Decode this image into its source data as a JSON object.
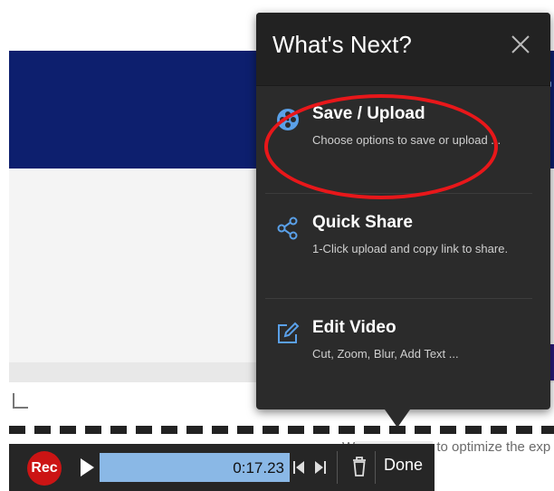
{
  "popup": {
    "title": "What's Next?",
    "close": "X",
    "options": [
      {
        "label": "Save / Upload",
        "desc": "Choose options to save or upload ..."
      },
      {
        "label": "Quick Share",
        "desc": "1-Click upload and copy link to share."
      },
      {
        "label": "Edit Video",
        "desc": "Cut, Zoom, Blur, Add Text ..."
      }
    ]
  },
  "background": {
    "partial_text_start": "W",
    "partial_text_end": "to optimize the exp"
  },
  "toolbar": {
    "rec_label": "Rec",
    "time": "0:17.23",
    "done_label": "Done"
  },
  "colors": {
    "highlight": "#e8171a",
    "rec": "#cc1414",
    "progress": "#8ab8e6",
    "banner": "#0d1f6e",
    "icon_blue": "#5aa0e8"
  }
}
